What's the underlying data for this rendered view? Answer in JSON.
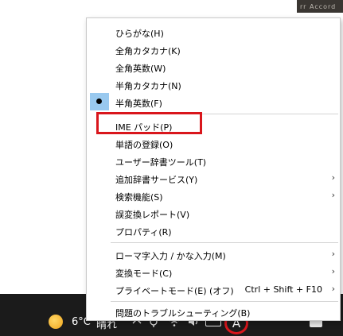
{
  "background": {
    "thumbnail_text": "rr Accord"
  },
  "taskbar": {
    "weather_temp": "6°C",
    "weather_condition": "晴れ",
    "ime_mode_glyph": "A",
    "icons": [
      "chevron-up-icon",
      "wifi-icon",
      "pen-icon",
      "volume-icon",
      "keyboard-icon",
      "ime-mode-icon",
      "notification-icon"
    ]
  },
  "menu": {
    "items": [
      {
        "label": "ひらがな(H)"
      },
      {
        "label": "全角カタカナ(K)"
      },
      {
        "label": "全角英数(W)"
      },
      {
        "label": "半角カタカナ(N)"
      },
      {
        "label": "半角英数(F)"
      },
      {
        "label": "IME パッド(P)"
      },
      {
        "label": "単語の登録(O)"
      },
      {
        "label": "ユーザー辞書ツール(T)"
      },
      {
        "label": "追加辞書サービス(Y)",
        "arrow": "›"
      },
      {
        "label": "検索機能(S)",
        "arrow": "›"
      },
      {
        "label": "誤変換レポート(V)"
      },
      {
        "label": "プロパティ(R)"
      },
      {
        "label": "ローマ字入力 / かな入力(M)",
        "arrow": "›"
      },
      {
        "label": "変換モード(C)",
        "arrow": "›"
      },
      {
        "label": "プライベートモード(E) (オフ)",
        "shortcut": "Ctrl + Shift + F10",
        "arrow": "›"
      },
      {
        "label": "問題のトラブルシューティング(B)"
      }
    ]
  },
  "colors": {
    "highlight_red": "#d9161c",
    "selected_bg": "#99c9ef",
    "taskbar_bg": "#1b1b1b"
  }
}
